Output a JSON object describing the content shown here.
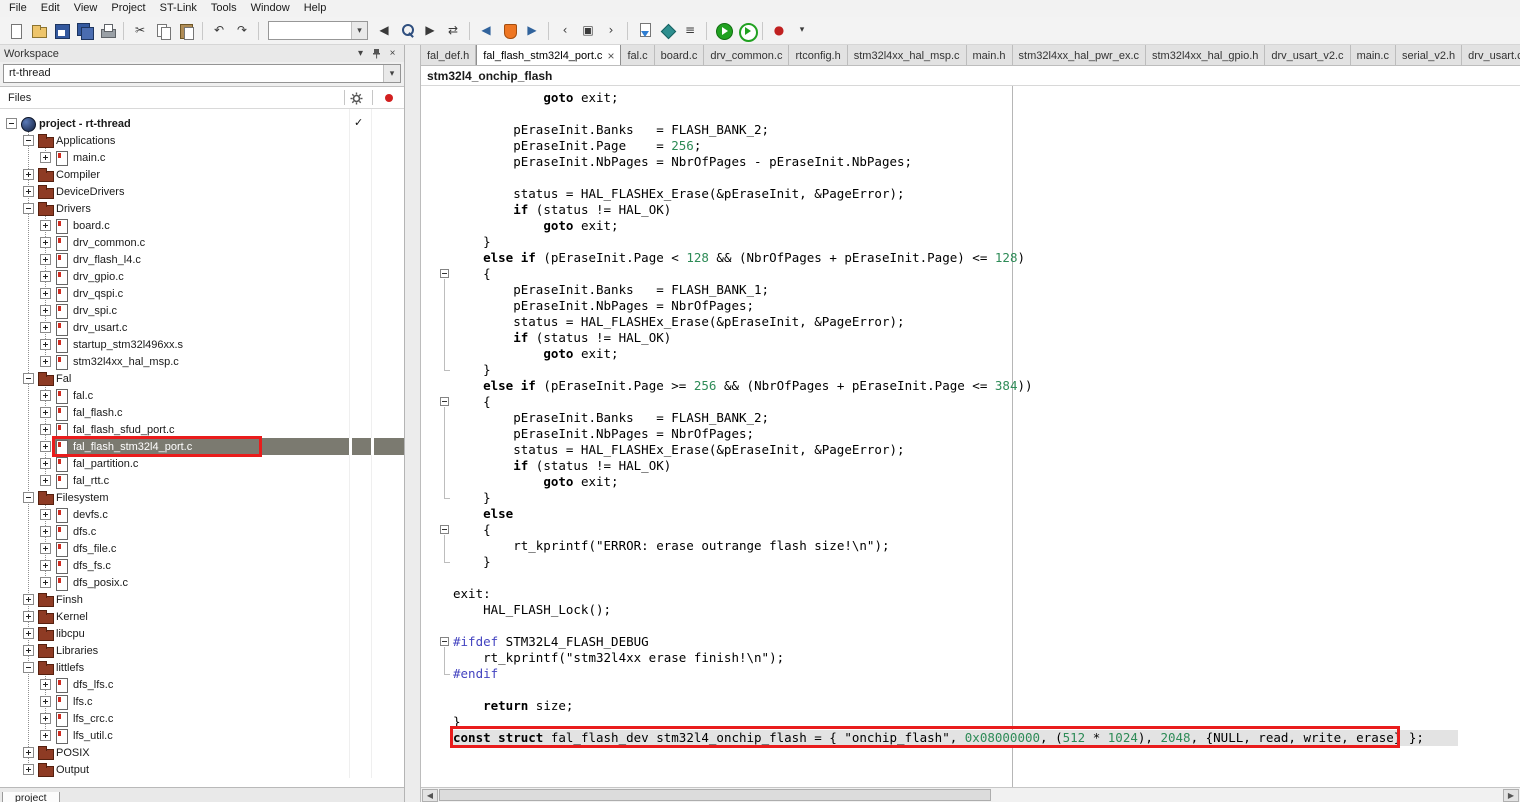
{
  "menubar": {
    "items": [
      "File",
      "Edit",
      "View",
      "Project",
      "ST-Link",
      "Tools",
      "Window",
      "Help"
    ]
  },
  "toolbar": {
    "items": [
      {
        "name": "new-document"
      },
      {
        "name": "open-file"
      },
      {
        "name": "save"
      },
      {
        "name": "save-all"
      },
      {
        "name": "print"
      },
      {
        "sep": true
      },
      {
        "name": "cut",
        "glyph": "✂"
      },
      {
        "name": "copy"
      },
      {
        "name": "paste"
      },
      {
        "sep": true
      },
      {
        "name": "undo",
        "glyph": "↶"
      },
      {
        "name": "redo",
        "glyph": "↷"
      },
      {
        "sep": true
      },
      {
        "name": "search-combo",
        "combo": true,
        "value": ""
      },
      {
        "name": "find-previous",
        "glyph": "◀"
      },
      {
        "name": "find"
      },
      {
        "name": "find-next",
        "glyph": "▶"
      },
      {
        "name": "replace",
        "glyph": "⇄"
      },
      {
        "sep": true
      },
      {
        "name": "navigate-back",
        "glyph": "◀",
        "color": "#31639c"
      },
      {
        "name": "st-link"
      },
      {
        "name": "navigate-forward",
        "glyph": "▶",
        "color": "#31639c"
      },
      {
        "sep": true
      },
      {
        "name": "previous-bookmark",
        "glyph": "‹"
      },
      {
        "name": "toggle-bookmark",
        "glyph": "▣"
      },
      {
        "name": "next-bookmark",
        "glyph": "›"
      },
      {
        "sep": true
      },
      {
        "name": "compile"
      },
      {
        "name": "make"
      },
      {
        "name": "batch-build",
        "glyph": "≡"
      },
      {
        "sep": true
      },
      {
        "name": "download-and-debug"
      },
      {
        "name": "debug-without-downloading"
      },
      {
        "sep": true
      },
      {
        "name": "breakpoint-toggle",
        "glyph": "●",
        "color": "#c02020"
      },
      {
        "name": "toolbar-options",
        "glyph": "▾",
        "small": true
      }
    ]
  },
  "workspace": {
    "title": "Workspace",
    "config_selector": "rt-thread",
    "files_header": "Files",
    "bottom_tab": "project",
    "tree": [
      {
        "label": "project - rt-thread",
        "level": 0,
        "expand": "open",
        "icon": "project",
        "bold": true,
        "check": true
      },
      {
        "label": "Applications",
        "level": 1,
        "expand": "open",
        "icon": "folder"
      },
      {
        "label": "main.c",
        "level": 2,
        "expand": "closed",
        "icon": "file"
      },
      {
        "label": "Compiler",
        "level": 1,
        "expand": "closed",
        "icon": "folder"
      },
      {
        "label": "DeviceDrivers",
        "level": 1,
        "expand": "closed",
        "icon": "folder"
      },
      {
        "label": "Drivers",
        "level": 1,
        "expand": "open",
        "icon": "folder"
      },
      {
        "label": "board.c",
        "level": 2,
        "expand": "closed",
        "icon": "file"
      },
      {
        "label": "drv_common.c",
        "level": 2,
        "expand": "closed",
        "icon": "file"
      },
      {
        "label": "drv_flash_l4.c",
        "level": 2,
        "expand": "closed",
        "icon": "file"
      },
      {
        "label": "drv_gpio.c",
        "level": 2,
        "expand": "closed",
        "icon": "file"
      },
      {
        "label": "drv_qspi.c",
        "level": 2,
        "expand": "closed",
        "icon": "file"
      },
      {
        "label": "drv_spi.c",
        "level": 2,
        "expand": "closed",
        "icon": "file"
      },
      {
        "label": "drv_usart.c",
        "level": 2,
        "expand": "closed",
        "icon": "file"
      },
      {
        "label": "startup_stm32l496xx.s",
        "level": 2,
        "expand": "closed",
        "icon": "file"
      },
      {
        "label": "stm32l4xx_hal_msp.c",
        "level": 2,
        "expand": "closed",
        "icon": "file"
      },
      {
        "label": "Fal",
        "level": 1,
        "expand": "open",
        "icon": "folder"
      },
      {
        "label": "fal.c",
        "level": 2,
        "expand": "closed",
        "icon": "file"
      },
      {
        "label": "fal_flash.c",
        "level": 2,
        "expand": "closed",
        "icon": "file"
      },
      {
        "label": "fal_flash_sfud_port.c",
        "level": 2,
        "expand": "closed",
        "icon": "file"
      },
      {
        "label": "fal_flash_stm32l4_port.c",
        "level": 2,
        "expand": "closed",
        "icon": "file",
        "selected": true,
        "annotated": true
      },
      {
        "label": "fal_partition.c",
        "level": 2,
        "expand": "closed",
        "icon": "file"
      },
      {
        "label": "fal_rtt.c",
        "level": 2,
        "expand": "closed",
        "icon": "file"
      },
      {
        "label": "Filesystem",
        "level": 1,
        "expand": "open",
        "icon": "folder"
      },
      {
        "label": "devfs.c",
        "level": 2,
        "expand": "closed",
        "icon": "file"
      },
      {
        "label": "dfs.c",
        "level": 2,
        "expand": "closed",
        "icon": "file"
      },
      {
        "label": "dfs_file.c",
        "level": 2,
        "expand": "closed",
        "icon": "file"
      },
      {
        "label": "dfs_fs.c",
        "level": 2,
        "expand": "closed",
        "icon": "file"
      },
      {
        "label": "dfs_posix.c",
        "level": 2,
        "expand": "closed",
        "icon": "file"
      },
      {
        "label": "Finsh",
        "level": 1,
        "expand": "closed",
        "icon": "folder"
      },
      {
        "label": "Kernel",
        "level": 1,
        "expand": "closed",
        "icon": "folder"
      },
      {
        "label": "libcpu",
        "level": 1,
        "expand": "closed",
        "icon": "folder"
      },
      {
        "label": "Libraries",
        "level": 1,
        "expand": "closed",
        "icon": "folder"
      },
      {
        "label": "littlefs",
        "level": 1,
        "expand": "open",
        "icon": "folder"
      },
      {
        "label": "dfs_lfs.c",
        "level": 2,
        "expand": "closed",
        "icon": "file"
      },
      {
        "label": "lfs.c",
        "level": 2,
        "expand": "closed",
        "icon": "file"
      },
      {
        "label": "lfs_crc.c",
        "level": 2,
        "expand": "closed",
        "icon": "file"
      },
      {
        "label": "lfs_util.c",
        "level": 2,
        "expand": "closed",
        "icon": "file"
      },
      {
        "label": "POSIX",
        "level": 1,
        "expand": "closed",
        "icon": "folder"
      },
      {
        "label": "Output",
        "level": 1,
        "expand": "closed",
        "icon": "folder"
      }
    ]
  },
  "editor": {
    "tabs": [
      {
        "label": "fal_def.h"
      },
      {
        "label": "fal_flash_stm32l4_port.c",
        "active": true
      },
      {
        "label": "fal.c"
      },
      {
        "label": "board.c"
      },
      {
        "label": "drv_common.c"
      },
      {
        "label": "rtconfig.h"
      },
      {
        "label": "stm32l4xx_hal_msp.c"
      },
      {
        "label": "main.h"
      },
      {
        "label": "stm32l4xx_hal_pwr_ex.c"
      },
      {
        "label": "stm32l4xx_hal_gpio.h"
      },
      {
        "label": "drv_usart_v2.c"
      },
      {
        "label": "main.c"
      },
      {
        "label": "serial_v2.h"
      },
      {
        "label": "drv_usart.c"
      }
    ],
    "breadcrumb": "stm32l4_onchip_flash",
    "code": {
      "lines": [
        {
          "t": [
            [
              "p",
              "            "
            ],
            [
              "k",
              "goto"
            ],
            [
              "p",
              " exit;"
            ]
          ]
        },
        {
          "t": []
        },
        {
          "t": [
            [
              "p",
              "        pEraseInit.Banks   = FLASH_BANK_2;"
            ]
          ]
        },
        {
          "t": [
            [
              "p",
              "        pEraseInit.Page    = "
            ],
            [
              "n",
              "256"
            ],
            [
              "p",
              ";"
            ]
          ]
        },
        {
          "t": [
            [
              "p",
              "        pEraseInit.NbPages = NbrOfPages - pEraseInit.NbPages;"
            ]
          ]
        },
        {
          "t": []
        },
        {
          "t": [
            [
              "p",
              "        status = HAL_FLASHEx_Erase(&pEraseInit, &PageError);"
            ]
          ]
        },
        {
          "t": [
            [
              "p",
              "        "
            ],
            [
              "k",
              "if"
            ],
            [
              "p",
              " (status != HAL_OK)"
            ]
          ]
        },
        {
          "t": [
            [
              "p",
              "            "
            ],
            [
              "k",
              "goto"
            ],
            [
              "p",
              " exit;"
            ]
          ]
        },
        {
          "t": [
            [
              "p",
              "    }"
            ]
          ]
        },
        {
          "t": [
            [
              "p",
              "    "
            ],
            [
              "k",
              "else"
            ],
            [
              "p",
              " "
            ],
            [
              "k",
              "if"
            ],
            [
              "p",
              " (pEraseInit.Page < "
            ],
            [
              "n",
              "128"
            ],
            [
              "p",
              " && (NbrOfPages + pEraseInit.Page) <= "
            ],
            [
              "n",
              "128"
            ],
            [
              "p",
              ")"
            ]
          ]
        },
        {
          "fold": "start",
          "t": [
            [
              "p",
              "    {"
            ]
          ]
        },
        {
          "fold": "mid",
          "t": [
            [
              "p",
              "        pEraseInit.Banks   = FLASH_BANK_1;"
            ]
          ]
        },
        {
          "fold": "mid",
          "t": [
            [
              "p",
              "        pEraseInit.NbPages = NbrOfPages;"
            ]
          ]
        },
        {
          "fold": "mid",
          "t": [
            [
              "p",
              "        status = HAL_FLASHEx_Erase(&pEraseInit, &PageError);"
            ]
          ]
        },
        {
          "fold": "mid",
          "t": [
            [
              "p",
              "        "
            ],
            [
              "k",
              "if"
            ],
            [
              "p",
              " (status != HAL_OK)"
            ]
          ]
        },
        {
          "fold": "mid",
          "t": [
            [
              "p",
              "            "
            ],
            [
              "k",
              "goto"
            ],
            [
              "p",
              " exit;"
            ]
          ]
        },
        {
          "fold": "end",
          "t": [
            [
              "p",
              "    }"
            ]
          ]
        },
        {
          "t": [
            [
              "p",
              "    "
            ],
            [
              "k",
              "else"
            ],
            [
              "p",
              " "
            ],
            [
              "k",
              "if"
            ],
            [
              "p",
              " (pEraseInit.Page >= "
            ],
            [
              "n",
              "256"
            ],
            [
              "p",
              " && (NbrOfPages + pEraseInit.Page <= "
            ],
            [
              "n",
              "384"
            ],
            [
              "p",
              "))"
            ]
          ]
        },
        {
          "fold": "start",
          "t": [
            [
              "p",
              "    {"
            ]
          ]
        },
        {
          "fold": "mid",
          "t": [
            [
              "p",
              "        pEraseInit.Banks   = FLASH_BANK_2;"
            ]
          ]
        },
        {
          "fold": "mid",
          "t": [
            [
              "p",
              "        pEraseInit.NbPages = NbrOfPages;"
            ]
          ]
        },
        {
          "fold": "mid",
          "t": [
            [
              "p",
              "        status = HAL_FLASHEx_Erase(&pEraseInit, &PageError);"
            ]
          ]
        },
        {
          "fold": "mid",
          "t": [
            [
              "p",
              "        "
            ],
            [
              "k",
              "if"
            ],
            [
              "p",
              " (status != HAL_OK)"
            ]
          ]
        },
        {
          "fold": "mid",
          "t": [
            [
              "p",
              "            "
            ],
            [
              "k",
              "goto"
            ],
            [
              "p",
              " exit;"
            ]
          ]
        },
        {
          "fold": "end",
          "t": [
            [
              "p",
              "    }"
            ]
          ]
        },
        {
          "t": [
            [
              "p",
              "    "
            ],
            [
              "k",
              "else"
            ]
          ]
        },
        {
          "fold": "start",
          "t": [
            [
              "p",
              "    {"
            ]
          ]
        },
        {
          "fold": "mid",
          "t": [
            [
              "p",
              "        rt_kprintf("
            ],
            [
              "s",
              "\"ERROR: erase outrange flash size!\\n\""
            ],
            [
              "p",
              ");"
            ]
          ]
        },
        {
          "fold": "end",
          "t": [
            [
              "p",
              "    }"
            ]
          ]
        },
        {
          "t": []
        },
        {
          "t": [
            [
              "p",
              "exit:"
            ]
          ]
        },
        {
          "t": [
            [
              "p",
              "    HAL_FLASH_Lock();"
            ]
          ]
        },
        {
          "t": []
        },
        {
          "fold": "start",
          "t": [
            [
              "d",
              "#ifdef"
            ],
            [
              "p",
              " STM32L4_FLASH_DEBUG"
            ]
          ]
        },
        {
          "fold": "mid",
          "t": [
            [
              "p",
              "    rt_kprintf("
            ],
            [
              "s",
              "\"stm32l4xx erase finish!\\n\""
            ],
            [
              "p",
              ");"
            ]
          ]
        },
        {
          "fold": "end",
          "t": [
            [
              "d",
              "#endif"
            ]
          ]
        },
        {
          "t": []
        },
        {
          "t": [
            [
              "p",
              "    "
            ],
            [
              "k",
              "return"
            ],
            [
              "p",
              " size;"
            ]
          ]
        },
        {
          "t": [
            [
              "p",
              "}"
            ]
          ]
        },
        {
          "hl": true,
          "t": [
            [
              "k",
              "const"
            ],
            [
              "p",
              " "
            ],
            [
              "k",
              "struct"
            ],
            [
              "p",
              " fal_flash_dev stm32l4_onchip_flash = { "
            ],
            [
              "s",
              "\"onchip_flash\""
            ],
            [
              "p",
              ", "
            ],
            [
              "n",
              "0x08000000"
            ],
            [
              "p",
              ", ("
            ],
            [
              "n",
              "512"
            ],
            [
              "p",
              " * "
            ],
            [
              "n",
              "1024"
            ],
            [
              "p",
              "), "
            ],
            [
              "n",
              "2048"
            ],
            [
              "p",
              ", {NULL, read, write, erase} };"
            ]
          ]
        }
      ]
    }
  },
  "colors": {
    "annotation": "#e91c1c",
    "selection": "#7b7a70",
    "number": "#2e8b57",
    "preprocessor": "#4343c0",
    "keyword": "#000000",
    "string": "#000000"
  }
}
